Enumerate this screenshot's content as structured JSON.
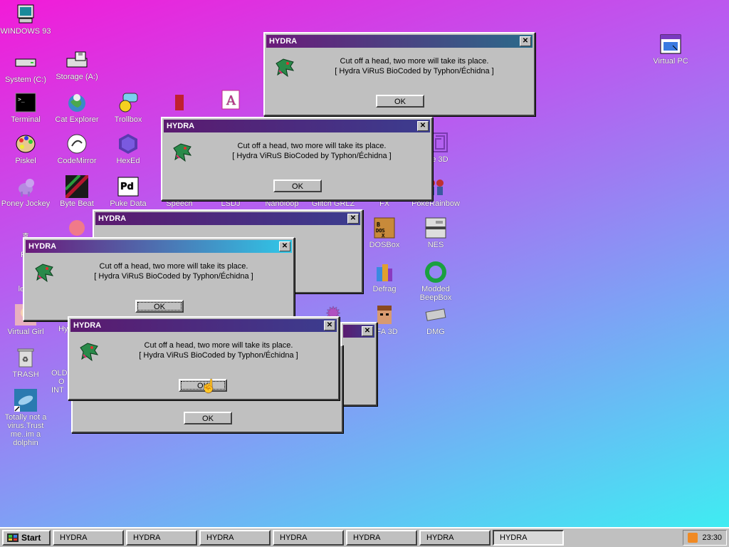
{
  "desktop_icons": {
    "windows93": "WINDOWS 93",
    "system_c": "System (C:)",
    "storage_a": "Storage (A:)",
    "terminal": "Terminal",
    "cat_explorer": "Cat Explorer",
    "trollbox": "Trollbox",
    "piskel": "Piskel",
    "codemirror": "CodeMirror",
    "hexed": "HexEd",
    "poney_jockey": "Poney Jockey",
    "byte_beat": "Byte Beat",
    "puke_data": "Puke Data",
    "speech": "Speech",
    "lsdj": "LSDJ",
    "nanoloop": "Nanoloop",
    "glitch_grlz": "Glitch GRLZ",
    "fx": "FX",
    "pokerainbow": "PokeRainbow",
    "dosbox": "DOSBox",
    "nes": "NES",
    "defrag": "Defrag",
    "modded_beepbox": "Modded BeepBox",
    "virtual_girl": "Virtual Girl",
    "afa3d": "AFA 3D",
    "dmg": "DMG",
    "trash": "TRASH",
    "dolphin": "Totally not a virus.Trust me..im a dolphin",
    "virtual_pc": "Virtual PC",
    "partial_ro": "Ro",
    "partial_lenn": "lenn",
    "partial_hy": "Hy",
    "partial_old": "OLD",
    "partial_o": "O",
    "partial_int": "INT",
    "partial_3d": "e 3D"
  },
  "dialog": {
    "title": "HYDRA",
    "close_glyph": "✕",
    "line1": "Cut off a head, two more will take its place.",
    "line2": "[ Hydra ViRuS BioCoded by Typhon/Échidna ]",
    "ok": "OK"
  },
  "taskbar": {
    "start": "Start",
    "items": [
      "HYDRA",
      "HYDRA",
      "HYDRA",
      "HYDRA",
      "HYDRA",
      "HYDRA",
      "HYDRA"
    ],
    "clock": "23:30"
  },
  "colors": {
    "title_gradient_start": "#6b1a7a",
    "title_gradient_end": "#2a6a8a",
    "face": "#c0c0c0"
  }
}
